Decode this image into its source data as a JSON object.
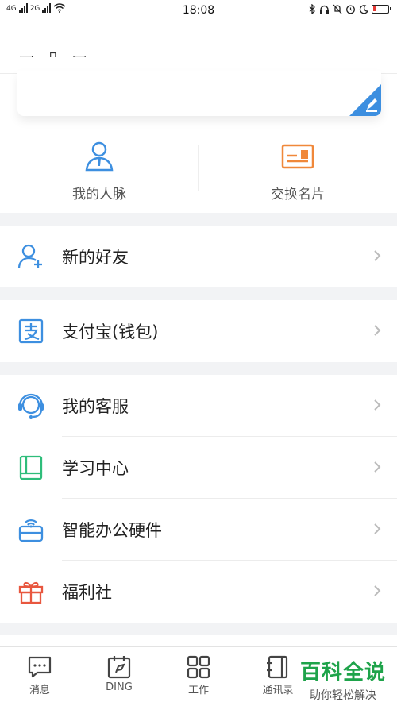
{
  "status_bar": {
    "net1": "4G",
    "net2": "2G",
    "time": "18:08"
  },
  "quick_actions": [
    {
      "label": "我的人脉",
      "icon": "contacts-person-icon",
      "color": "#3d8fe0"
    },
    {
      "label": "交换名片",
      "icon": "business-card-icon",
      "color": "#f0883a"
    }
  ],
  "menu": {
    "new_friend": {
      "label": "新的好友",
      "icon": "add-friend-icon"
    },
    "alipay": {
      "label": "支付宝(钱包)",
      "icon": "alipay-icon"
    },
    "customer_service": {
      "label": "我的客服",
      "icon": "headset-icon"
    },
    "learning": {
      "label": "学习中心",
      "icon": "book-icon"
    },
    "hardware": {
      "label": "智能办公硬件",
      "icon": "smart-device-icon"
    },
    "welfare": {
      "label": "福利社",
      "icon": "gift-icon"
    }
  },
  "tabs": [
    {
      "label": "消息",
      "icon": "message-icon"
    },
    {
      "label": "DING",
      "icon": "ding-icon"
    },
    {
      "label": "工作",
      "icon": "grid-icon"
    },
    {
      "label": "通讯录",
      "icon": "address-book-icon"
    }
  ],
  "watermark": {
    "title": "百科全说",
    "subtitle": "助你轻松解决"
  },
  "colors": {
    "accent_blue": "#3d8fe0",
    "accent_orange": "#f0883a",
    "accent_green": "#2ebd7a",
    "accent_red": "#e8573f",
    "watermark_green": "#1ea34a"
  }
}
